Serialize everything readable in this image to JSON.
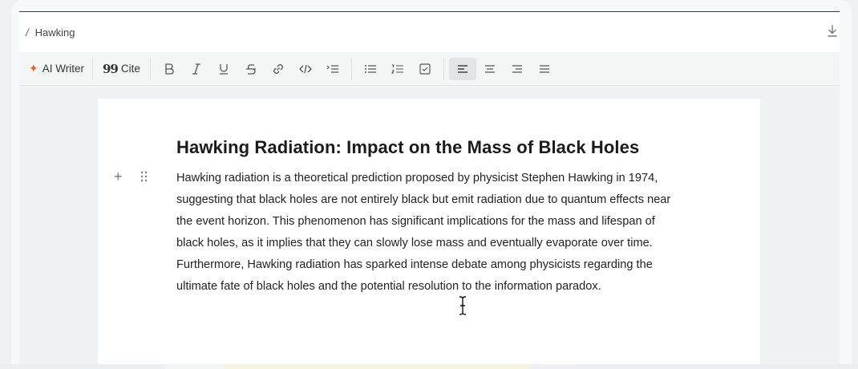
{
  "breadcrumb": {
    "separator": "/",
    "title": "Hawking"
  },
  "toolbar": {
    "ai_writer_label": "AI Writer",
    "cite_label": "Cite",
    "cite_quote_glyph": "99",
    "active_alignment": "align-left"
  },
  "document": {
    "heading": "Hawking Radiation: Impact on the Mass of Black Holes",
    "paragraph": "Hawking radiation is a theoretical prediction proposed by physicist Stephen Hawking in 1974, suggesting that black holes are not entirely black but emit radiation due to quantum effects near the event horizon. This phenomenon has significant implications for the mass and lifespan of black holes, as it implies that they can slowly lose mass and eventually evaporate over time. Furthermore, Hawking radiation has sparked intense debate among physicists regarding the ultimate fate of black holes and the potential resolution to the information paradox."
  },
  "colors": {
    "accent": "#e8642c",
    "text": "#222222",
    "panel_bg": "#f0f1f2"
  }
}
